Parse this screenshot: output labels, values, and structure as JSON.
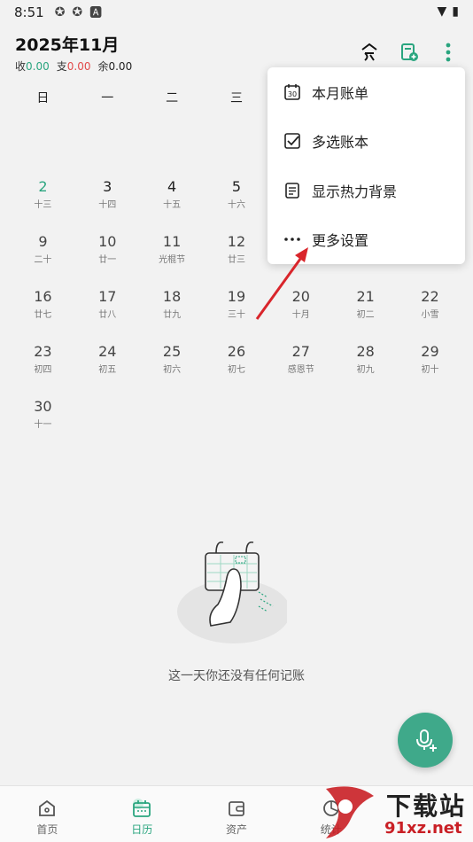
{
  "status_bar": {
    "time": "8:51",
    "icons": [
      "gear-icon",
      "gear-icon",
      "a-badge-icon"
    ],
    "right_icons": [
      "wifi-icon",
      "battery-icon"
    ]
  },
  "header": {
    "month": "2025年11月",
    "income_label": "收",
    "income_value": "0.00",
    "expense_label": "支",
    "expense_value": "0.00",
    "balance_label": "余",
    "balance_value": "0.00",
    "buttons": [
      "today-icon",
      "add-ledger-icon",
      "more-vert-icon"
    ]
  },
  "weekdays": [
    "日",
    "一",
    "二",
    "三",
    "四",
    "五",
    "六"
  ],
  "calendar": {
    "rows": [
      [
        {
          "d": "2",
          "l": "十三",
          "state": "selected"
        },
        {
          "d": "3",
          "l": "十四",
          "state": ""
        },
        {
          "d": "4",
          "l": "十五",
          "state": ""
        },
        {
          "d": "5",
          "l": "十六",
          "state": ""
        },
        {
          "d": "",
          "l": "",
          "state": "hidden"
        },
        {
          "d": "",
          "l": "",
          "state": "hidden"
        },
        {
          "d": "",
          "l": "",
          "state": "hidden"
        }
      ],
      [
        {
          "d": "9",
          "l": "二十",
          "state": "future"
        },
        {
          "d": "10",
          "l": "廿一",
          "state": "future"
        },
        {
          "d": "11",
          "l": "光棍节",
          "state": "future"
        },
        {
          "d": "12",
          "l": "廿三",
          "state": "future"
        },
        {
          "d": "",
          "l": "",
          "state": "hidden"
        },
        {
          "d": "",
          "l": "",
          "state": "hidden"
        },
        {
          "d": "",
          "l": "",
          "state": "hidden"
        }
      ],
      [
        {
          "d": "16",
          "l": "廿七",
          "state": "future"
        },
        {
          "d": "17",
          "l": "廿八",
          "state": "future"
        },
        {
          "d": "18",
          "l": "廿九",
          "state": "future"
        },
        {
          "d": "19",
          "l": "三十",
          "state": "future"
        },
        {
          "d": "20",
          "l": "十月",
          "state": "future"
        },
        {
          "d": "21",
          "l": "初二",
          "state": "future"
        },
        {
          "d": "22",
          "l": "小雪",
          "state": "future"
        }
      ],
      [
        {
          "d": "23",
          "l": "初四",
          "state": "future"
        },
        {
          "d": "24",
          "l": "初五",
          "state": "future"
        },
        {
          "d": "25",
          "l": "初六",
          "state": "future"
        },
        {
          "d": "26",
          "l": "初七",
          "state": "future"
        },
        {
          "d": "27",
          "l": "感恩节",
          "state": "future"
        },
        {
          "d": "28",
          "l": "初九",
          "state": "future"
        },
        {
          "d": "29",
          "l": "初十",
          "state": "future"
        }
      ],
      [
        {
          "d": "30",
          "l": "十一",
          "state": "future"
        }
      ]
    ]
  },
  "empty": {
    "text": "这一天你还没有任何记账"
  },
  "fab": {
    "icon": "voice-add-icon"
  },
  "menu": {
    "items": [
      {
        "label": "本月账单",
        "icon": "calendar-30-icon"
      },
      {
        "label": "多选账本",
        "icon": "checkbox-icon"
      },
      {
        "label": "显示热力背景",
        "icon": "document-icon"
      },
      {
        "label": "更多设置",
        "icon": "more-dots-icon"
      }
    ]
  },
  "bottom_nav": {
    "items": [
      {
        "label": "首页",
        "icon": "home-icon",
        "active": false
      },
      {
        "label": "日历",
        "icon": "calendar-icon",
        "active": true
      },
      {
        "label": "资产",
        "icon": "wallet-icon",
        "active": false
      },
      {
        "label": "统计",
        "icon": "stats-icon",
        "active": false
      }
    ]
  },
  "watermark": {
    "top": "下载站",
    "bottom": "91xz.net"
  },
  "colors": {
    "accent": "#2aa57f",
    "expense": "#e24a4a",
    "fab": "#3fa98a",
    "arrow": "#d9252b"
  }
}
